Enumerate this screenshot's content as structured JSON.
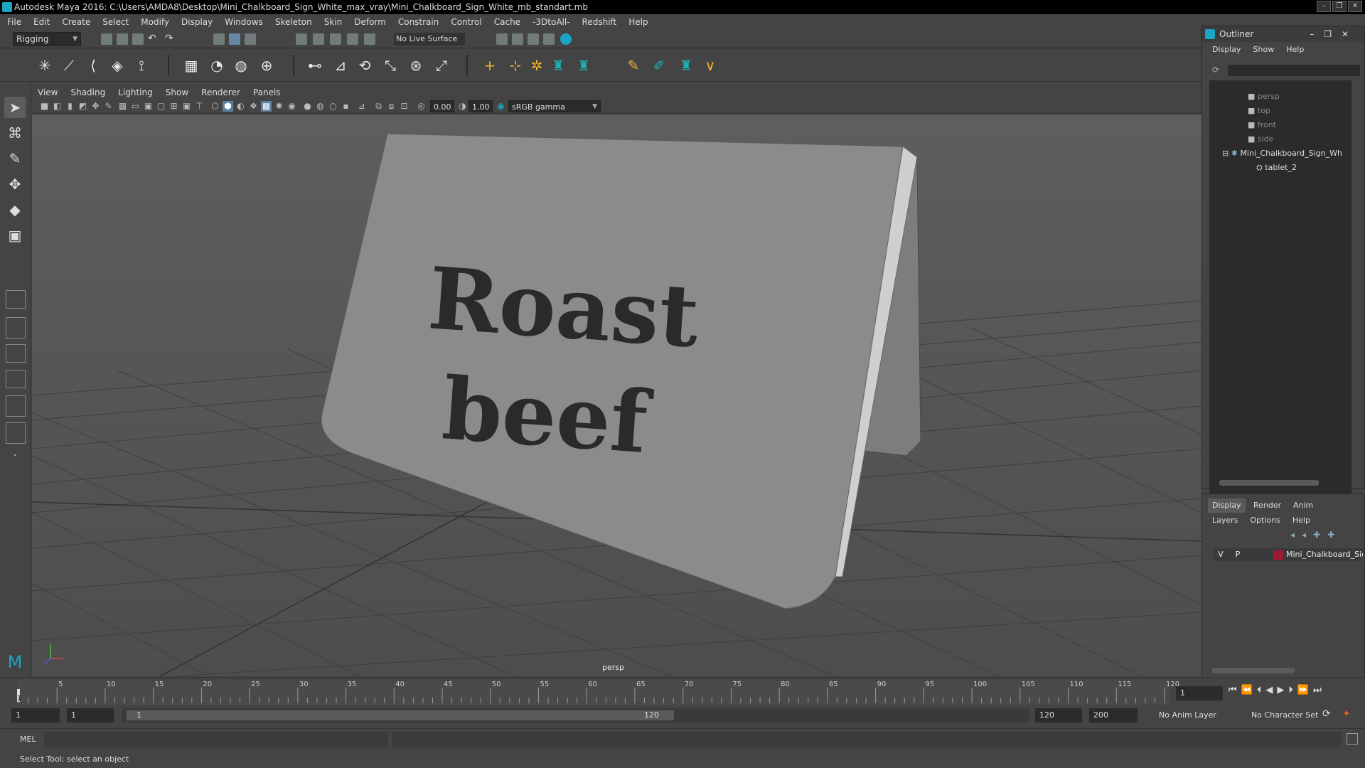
{
  "window": {
    "title": "Autodesk Maya 2016: C:\\Users\\AMDA8\\Desktop\\Mini_Chalkboard_Sign_White_max_vray\\Mini_Chalkboard_Sign_White_mb_standart.mb"
  },
  "menubar": [
    "File",
    "Edit",
    "Create",
    "Select",
    "Modify",
    "Display",
    "Windows",
    "Skeleton",
    "Skin",
    "Deform",
    "Constrain",
    "Control",
    "Cache",
    "-3DtoAll-",
    "Redshift",
    "Help"
  ],
  "statusline": {
    "mode": "Rigging",
    "live_surface": "No Live Surface"
  },
  "panel_menu": [
    "View",
    "Shading",
    "Lighting",
    "Show",
    "Renderer",
    "Panels"
  ],
  "panel_toolbar": {
    "exposure": "0.00",
    "gamma": "1.00",
    "color_space": "sRGB gamma"
  },
  "viewport": {
    "camera_label": "persp",
    "sign_text_line1": "Roast",
    "sign_text_line2": "beef"
  },
  "timeline": {
    "ticks": [
      "5",
      "10",
      "15",
      "20",
      "25",
      "30",
      "35",
      "40",
      "45",
      "50",
      "55",
      "60",
      "65",
      "70",
      "75",
      "80",
      "85",
      "90",
      "95",
      "100",
      "105",
      "110",
      "115",
      "120"
    ],
    "current_frame": "1",
    "start": "1",
    "playback_start": "1",
    "range_start": "1",
    "range_end": "120",
    "playback_end": "120",
    "anim_end": "200",
    "anim_layer": "No Anim Layer",
    "character_set": "No Character Set"
  },
  "cmdline": {
    "lang": "MEL"
  },
  "helpline": {
    "text": "Select Tool: select an object"
  },
  "outliner": {
    "title": "Outliner",
    "menus": [
      "Display",
      "Show",
      "Help"
    ],
    "items": [
      "persp",
      "top",
      "front",
      "side",
      "Mini_Chalkboard_Sign_Wh",
      "tablet_2"
    ]
  },
  "layers": {
    "tabs": [
      "Display",
      "Render",
      "Anim"
    ],
    "menus": [
      "Layers",
      "Options",
      "Help"
    ],
    "row": {
      "v": "V",
      "p": "P",
      "name": "Mini_Chalkboard_Sign",
      "color": "#a01a33"
    }
  }
}
